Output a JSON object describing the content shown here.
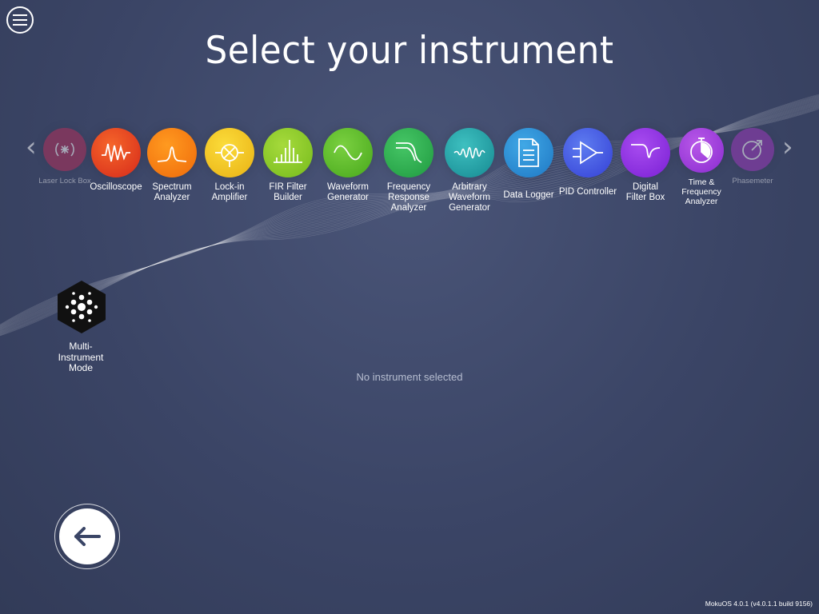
{
  "header": {
    "title": "Select your instrument"
  },
  "instruments": [
    {
      "label_lines": [
        "Laser Lock Box"
      ],
      "icon": "laser-lock-box-icon",
      "color": "#b0305a",
      "dim": true
    },
    {
      "label_lines": [
        "Oscilloscope"
      ],
      "icon": "oscilloscope-icon",
      "color": "#e8401e",
      "dim": false
    },
    {
      "label_lines": [
        "Spectrum",
        "Analyzer"
      ],
      "icon": "spectrum-analyzer-icon",
      "color": "#f57a10",
      "dim": false
    },
    {
      "label_lines": [
        "Lock-in",
        "Amplifier"
      ],
      "icon": "lock-in-amplifier-icon",
      "color": "#f2c21a",
      "dim": false
    },
    {
      "label_lines": [
        "FIR Filter",
        "Builder"
      ],
      "icon": "fir-filter-icon",
      "color": "#8ecb28",
      "dim": false
    },
    {
      "label_lines": [
        "Waveform",
        "Generator"
      ],
      "icon": "waveform-generator-icon",
      "color": "#5cbc2c",
      "dim": false
    },
    {
      "label_lines": [
        "Frequency",
        "Response",
        "Analyzer"
      ],
      "icon": "frequency-response-icon",
      "color": "#2bb250",
      "dim": false
    },
    {
      "label_lines": [
        "Arbitrary",
        "Waveform",
        "Generator"
      ],
      "icon": "arbitrary-waveform-icon",
      "color": "#22a6a0",
      "dim": false
    },
    {
      "label_lines": [
        "Data Logger"
      ],
      "icon": "data-logger-icon",
      "color": "#2a8ed0",
      "dim": false
    },
    {
      "label_lines": [
        "PID Controller"
      ],
      "icon": "pid-controller-icon",
      "color": "#3e5ee0",
      "dim": false
    },
    {
      "label_lines": [
        "Digital",
        "Filter Box"
      ],
      "icon": "digital-filter-icon",
      "color": "#8a2ee0",
      "dim": false
    },
    {
      "label_lines": [
        "Time &",
        "Frequency",
        "Analyzer"
      ],
      "icon": "stopwatch-icon",
      "color": "#a23ad8",
      "dim": false
    },
    {
      "label_lines": [
        "Phasemeter"
      ],
      "icon": "phasemeter-icon",
      "color": "#9a38b8",
      "dim": true
    }
  ],
  "multi": {
    "label_lines": [
      "Multi-",
      "Instrument",
      "Mode"
    ]
  },
  "status": {
    "text": "No instrument selected"
  },
  "footer": {
    "version": "MokuOS 4.0.1 (v4.0.1.1 build 9156)"
  },
  "nav": {
    "prev": "‹",
    "next": "›"
  }
}
